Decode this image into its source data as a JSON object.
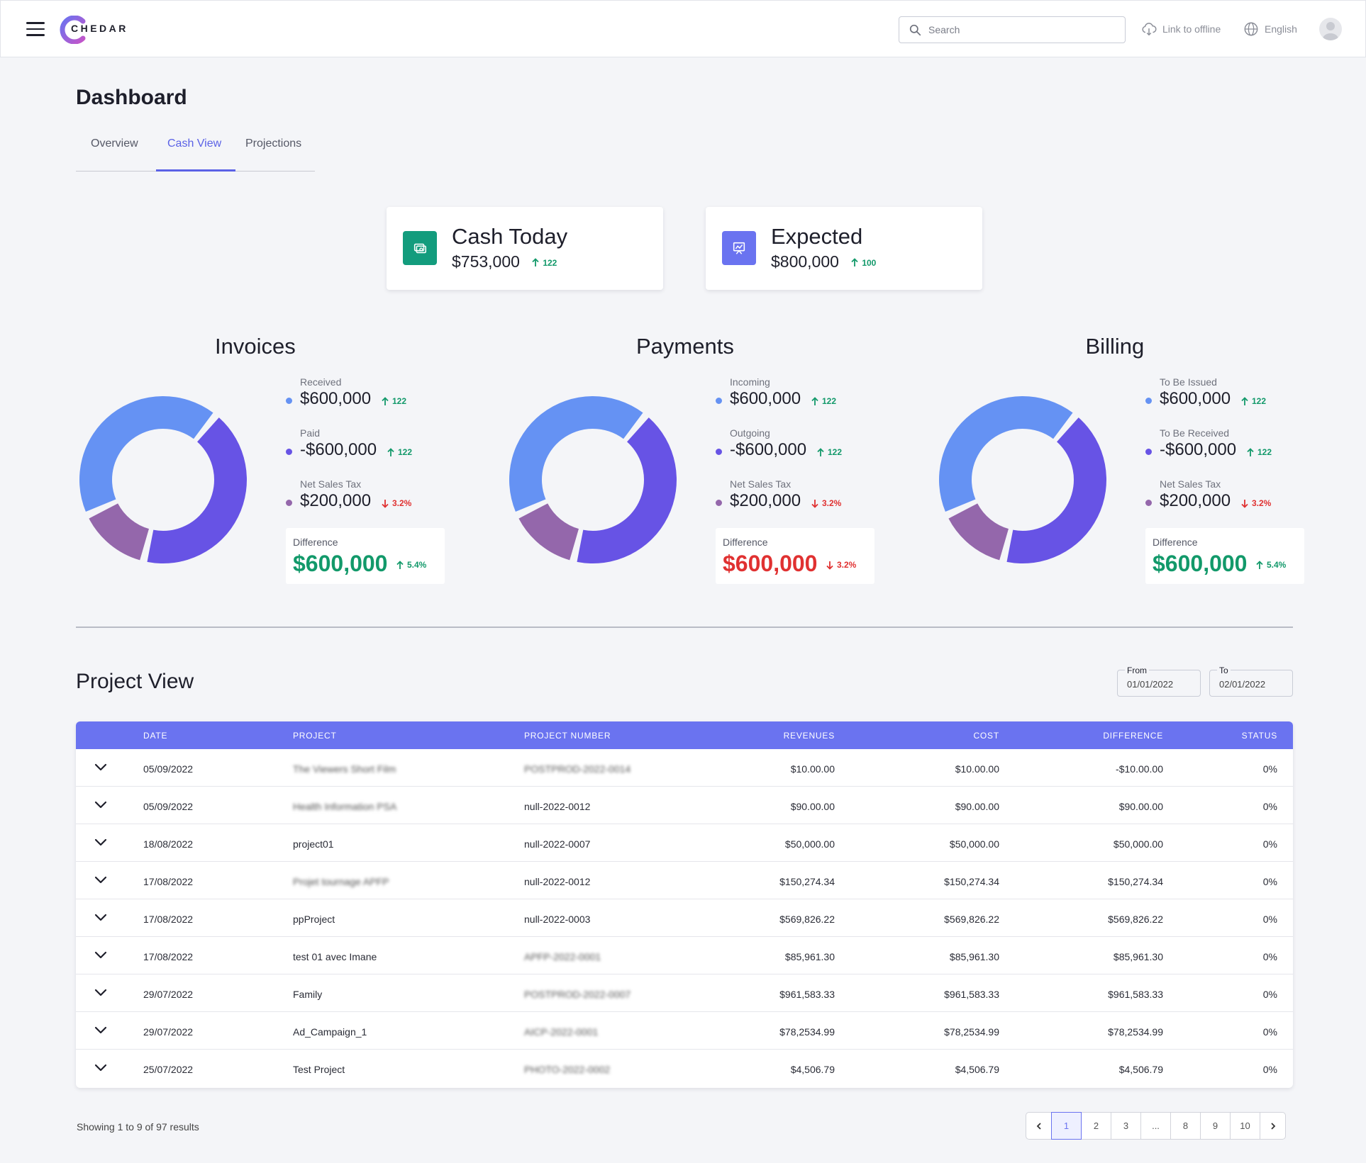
{
  "app": {
    "logo_text": "CHEDAR"
  },
  "topbar": {
    "search_placeholder": "Search",
    "offline_label": "Link to offline",
    "language_label": "English"
  },
  "page": {
    "title": "Dashboard"
  },
  "tabs": [
    {
      "label": "Overview"
    },
    {
      "label": "Cash View",
      "active": true
    },
    {
      "label": "Projections"
    }
  ],
  "summary_cards": [
    {
      "title": "Cash Today",
      "value": "$753,000",
      "delta": "122",
      "icon": "money-icon",
      "color": "#139c7d"
    },
    {
      "title": "Expected",
      "value": "$800,000",
      "delta": "100",
      "icon": "presentation-chart-icon",
      "color": "#6a73f0"
    }
  ],
  "colors": {
    "blue": "#6592f3",
    "indigo": "#6753e5",
    "purple": "#9467ab",
    "green": "#12996a",
    "red": "#e03131",
    "accent": "#6a73f0"
  },
  "sections": [
    {
      "title": "Invoices",
      "legend": [
        {
          "label": "Received",
          "value": "$600,000",
          "delta": "122",
          "direction": "up"
        },
        {
          "label": "Paid",
          "value": "-$600,000",
          "delta": "122",
          "direction": "up"
        },
        {
          "label": "Net Sales Tax",
          "value": "$200,000",
          "delta": "3.2%",
          "direction": "down"
        }
      ],
      "difference": {
        "label": "Difference",
        "value": "$600,000",
        "delta": "5.4%",
        "direction": "up"
      }
    },
    {
      "title": "Payments",
      "legend": [
        {
          "label": "Incoming",
          "value": "$600,000",
          "delta": "122",
          "direction": "up"
        },
        {
          "label": "Outgoing",
          "value": "-$600,000",
          "delta": "122",
          "direction": "up"
        },
        {
          "label": "Net Sales Tax",
          "value": "$200,000",
          "delta": "3.2%",
          "direction": "down"
        }
      ],
      "difference": {
        "label": "Difference",
        "value": "$600,000",
        "delta": "3.2%",
        "direction": "down"
      }
    },
    {
      "title": "Billing",
      "legend": [
        {
          "label": "To Be Issued",
          "value": "$600,000",
          "delta": "122",
          "direction": "up"
        },
        {
          "label": "To Be Received",
          "value": "-$600,000",
          "delta": "122",
          "direction": "up"
        },
        {
          "label": "Net Sales Tax",
          "value": "$200,000",
          "delta": "3.2%",
          "direction": "down"
        }
      ],
      "difference": {
        "label": "Difference",
        "value": "$600,000",
        "delta": "5.4%",
        "direction": "up"
      }
    }
  ],
  "project_view": {
    "title": "Project View",
    "from_label": "From",
    "from_value": "01/01/2022",
    "to_label": "To",
    "to_value": "02/01/2022",
    "columns": [
      "DATE",
      "PROJECT",
      "PROJECT NUMBER",
      "REVENUES",
      "COST",
      "DIFFERENCE",
      "STATUS"
    ],
    "rows": [
      {
        "date": "05/09/2022",
        "project": "The Viewers Short Film",
        "project_blur": true,
        "number": "POSTPROD-2022-0014",
        "number_blur": true,
        "revenues": "$10.00.00",
        "cost": "$10.00.00",
        "difference": "-$10.00.00",
        "status": "0%"
      },
      {
        "date": "05/09/2022",
        "project": "Health Information PSA",
        "project_blur": true,
        "number": "null-2022-0012",
        "number_blur": false,
        "revenues": "$90.00.00",
        "cost": "$90.00.00",
        "difference": "$90.00.00",
        "status": "0%"
      },
      {
        "date": "18/08/2022",
        "project": "project01",
        "project_blur": false,
        "number": "null-2022-0007",
        "number_blur": false,
        "revenues": "$50,000.00",
        "cost": "$50,000.00",
        "difference": "$50,000.00",
        "status": "0%"
      },
      {
        "date": "17/08/2022",
        "project": "Projet tournage APFP",
        "project_blur": true,
        "number": "null-2022-0012",
        "number_blur": false,
        "revenues": "$150,274.34",
        "cost": "$150,274.34",
        "difference": "$150,274.34",
        "status": "0%"
      },
      {
        "date": "17/08/2022",
        "project": "ppProject",
        "project_blur": false,
        "number": "null-2022-0003",
        "number_blur": false,
        "revenues": "$569,826.22",
        "cost": "$569,826.22",
        "difference": "$569,826.22",
        "status": "0%"
      },
      {
        "date": "17/08/2022",
        "project": "test 01 avec Imane",
        "project_blur": false,
        "number": "APFP-2022-0001",
        "number_blur": true,
        "revenues": "$85,961.30",
        "cost": "$85,961.30",
        "difference": "$85,961.30",
        "status": "0%"
      },
      {
        "date": "29/07/2022",
        "project": "Family",
        "project_blur": false,
        "number": "POSTPROD-2022-0007",
        "number_blur": true,
        "revenues": "$961,583.33",
        "cost": "$961,583.33",
        "difference": "$961,583.33",
        "status": "0%"
      },
      {
        "date": "29/07/2022",
        "project": "Ad_Campaign_1",
        "project_blur": false,
        "number": "AICP-2022-0001",
        "number_blur": true,
        "revenues": "$78,2534.99",
        "cost": "$78,2534.99",
        "difference": "$78,2534.99",
        "status": "0%"
      },
      {
        "date": "25/07/2022",
        "project": "Test Project",
        "project_blur": false,
        "number": "PHOTO-2022-0002",
        "number_blur": true,
        "revenues": "$4,506.79",
        "cost": "$4,506.79",
        "difference": "$4,506.79",
        "status": "0%"
      }
    ],
    "showing_text": "Showing 1 to 9 of 97 results",
    "pages": [
      "1",
      "2",
      "3",
      "...",
      "8",
      "9",
      "10"
    ],
    "current_page": "1"
  },
  "chart_data": [
    {
      "type": "pie",
      "title": "Invoices",
      "categories": [
        "Received",
        "Paid",
        "Net Sales Tax"
      ],
      "values": [
        600000,
        600000,
        200000
      ]
    },
    {
      "type": "pie",
      "title": "Payments",
      "categories": [
        "Incoming",
        "Outgoing",
        "Net Sales Tax"
      ],
      "values": [
        600000,
        600000,
        200000
      ]
    },
    {
      "type": "pie",
      "title": "Billing",
      "categories": [
        "To Be Issued",
        "To Be Received",
        "Net Sales Tax"
      ],
      "values": [
        600000,
        600000,
        200000
      ]
    }
  ]
}
